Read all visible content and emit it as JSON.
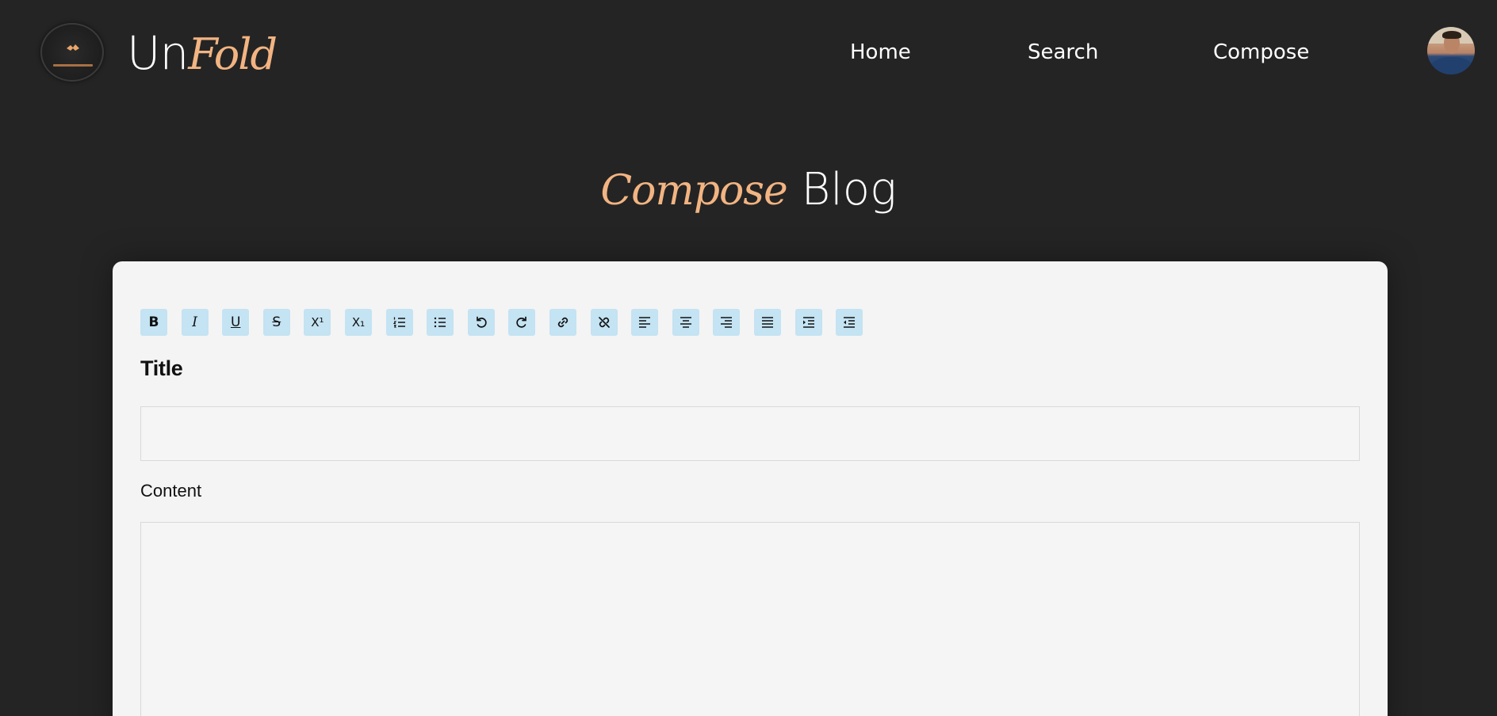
{
  "header": {
    "logo_icon": "unfold-logo",
    "brand": {
      "part1": "Un",
      "part2": "Fold"
    },
    "nav": {
      "home": "Home",
      "search": "Search",
      "compose": "Compose"
    },
    "avatar_icon": "user-avatar"
  },
  "page": {
    "title_accent": "Compose",
    "title_rest": " Blog"
  },
  "toolbar": {
    "buttons": [
      {
        "icon": "bold-icon",
        "glyph": "B"
      },
      {
        "icon": "italic-icon",
        "glyph": "I"
      },
      {
        "icon": "underline-icon",
        "glyph": "U"
      },
      {
        "icon": "strikethrough-icon",
        "glyph": "S"
      },
      {
        "icon": "superscript-icon",
        "glyph": "X¹"
      },
      {
        "icon": "subscript-icon",
        "glyph": "X₁"
      },
      {
        "icon": "ordered-list-icon"
      },
      {
        "icon": "unordered-list-icon"
      },
      {
        "icon": "undo-icon"
      },
      {
        "icon": "redo-icon"
      },
      {
        "icon": "link-icon"
      },
      {
        "icon": "unlink-icon"
      },
      {
        "icon": "align-left-icon"
      },
      {
        "icon": "align-center-icon"
      },
      {
        "icon": "align-right-icon"
      },
      {
        "icon": "align-justify-icon"
      },
      {
        "icon": "indent-icon"
      },
      {
        "icon": "outdent-icon"
      }
    ]
  },
  "form": {
    "title_label": "Title",
    "title_value": "",
    "content_label": "Content",
    "content_value": ""
  },
  "colors": {
    "background": "#242424",
    "accent": "#f2b482",
    "card": "#f4f4f4",
    "toolbar_button": "#c4e3f3"
  }
}
